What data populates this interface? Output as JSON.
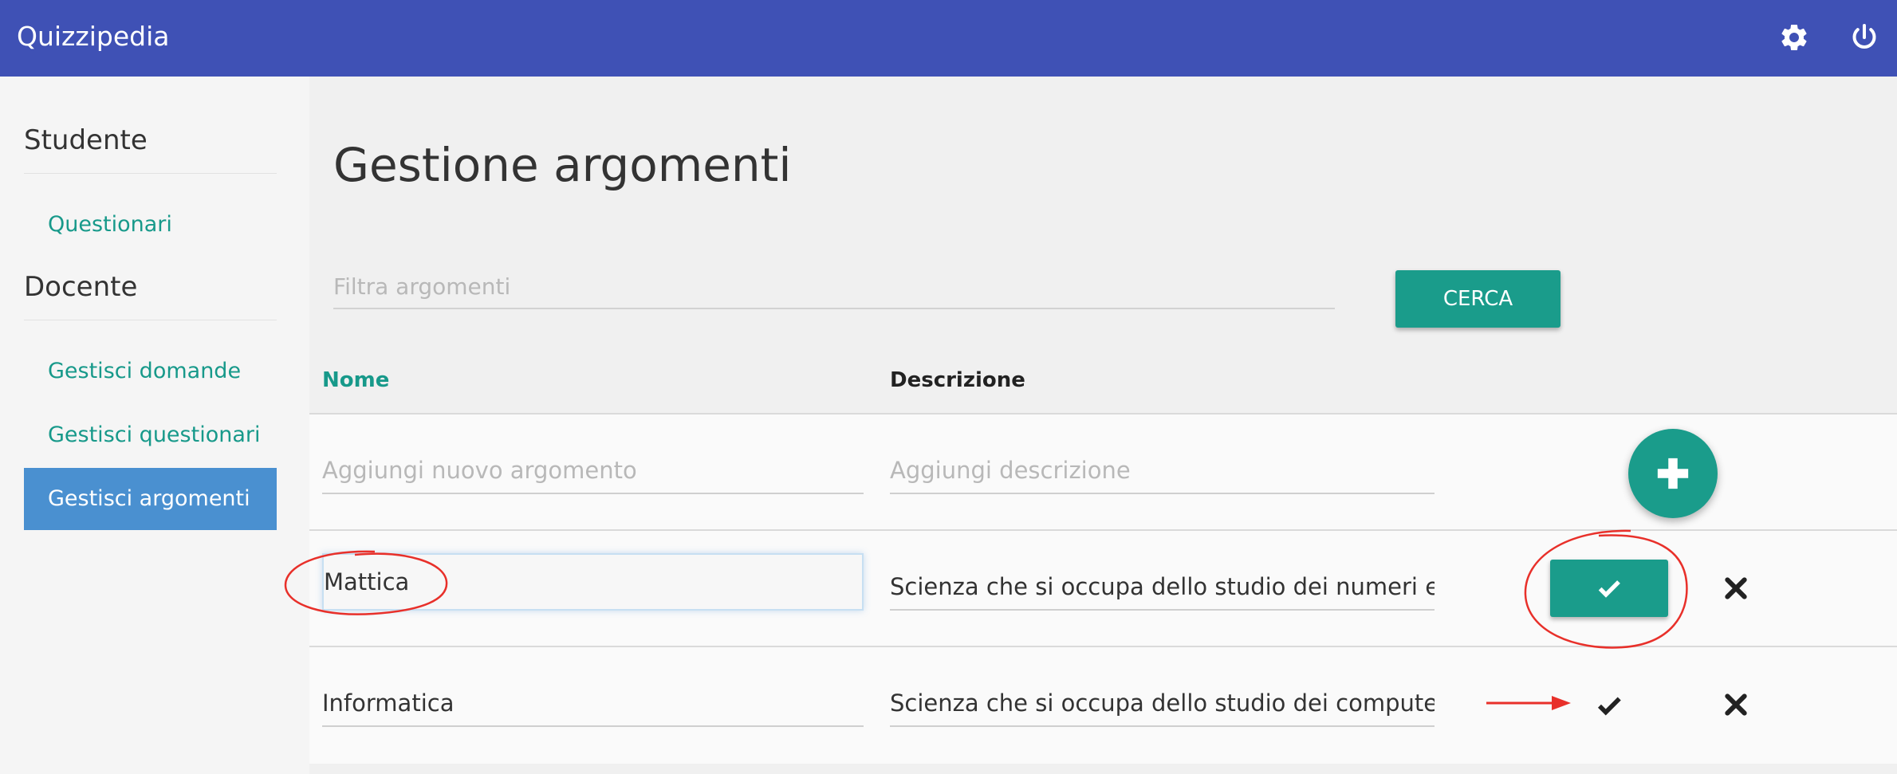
{
  "app": {
    "title": "Quizzipedia"
  },
  "topbar": {
    "settings_icon": "gear-icon",
    "logout_icon": "power-icon"
  },
  "sidebar": {
    "sections": [
      {
        "title": "Studente",
        "items": [
          {
            "label": "Questionari",
            "active": false
          }
        ]
      },
      {
        "title": "Docente",
        "items": [
          {
            "label": "Gestisci domande",
            "active": false
          },
          {
            "label": "Gestisci questionari",
            "active": false
          },
          {
            "label": "Gestisci argomenti",
            "active": true
          }
        ]
      }
    ]
  },
  "main": {
    "title": "Gestione argomenti",
    "filter": {
      "placeholder": "Filtra argomenti",
      "value": ""
    },
    "search_button": "CERCA",
    "table": {
      "columns": [
        "Nome",
        "Descrizione"
      ],
      "new_row": {
        "name_placeholder": "Aggiungi nuovo argomento",
        "desc_placeholder": "Aggiungi descrizione",
        "add_icon": "plus-icon"
      },
      "rows": [
        {
          "name": "Mattica",
          "description": "Scienza che si occupa dello studio dei numeri e d",
          "editing": true,
          "confirm_icon": "check-icon",
          "delete_icon": "close-icon"
        },
        {
          "name": "Informatica",
          "description": "Scienza che si occupa dello studio dei computer",
          "editing": false,
          "confirm_icon": "check-icon",
          "delete_icon": "close-icon"
        }
      ]
    }
  },
  "colors": {
    "header": "#3f51b5",
    "accent": "#1a9c8b",
    "active_nav": "#4a90d0",
    "annotation": "#e8302a"
  }
}
